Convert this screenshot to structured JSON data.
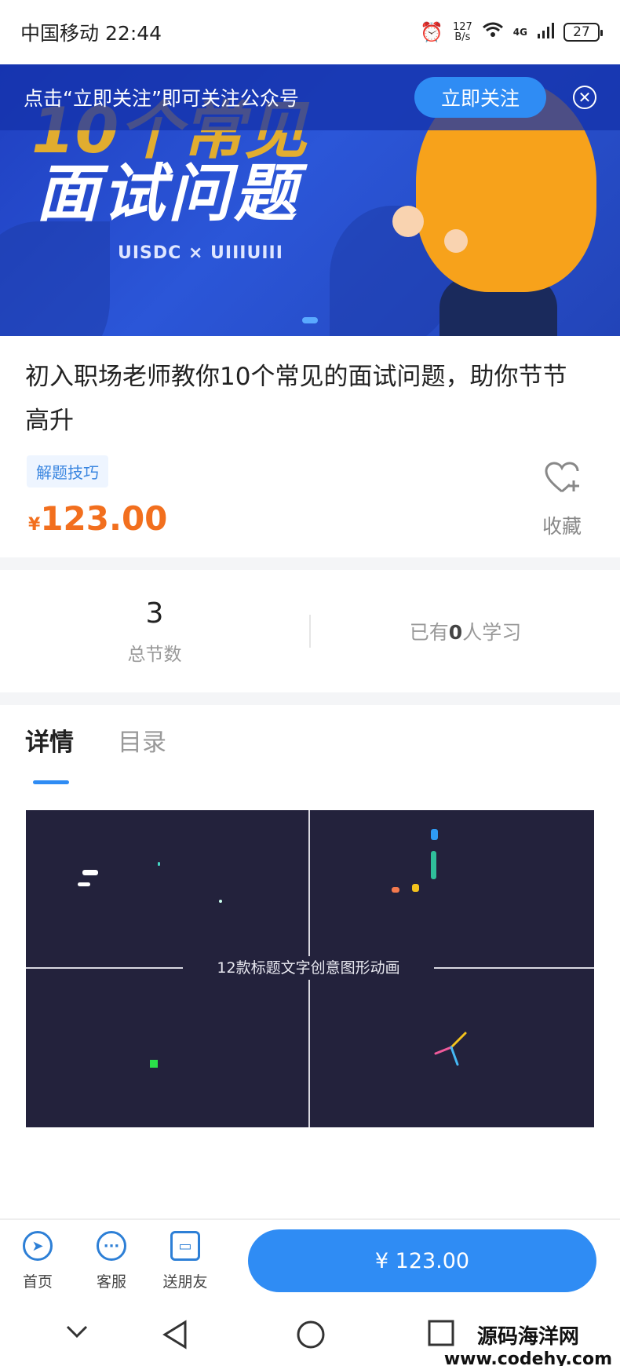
{
  "status_bar": {
    "carrier": "中国移动",
    "time": "22:44",
    "net_speed": "127",
    "net_unit": "B/s",
    "signal": "4G",
    "battery": "27"
  },
  "banner": {
    "headline_top": "10个常见",
    "headline": "面试问题",
    "subtitle": "UISDC × UIIIUIII",
    "follow_text": "点击“立即关注”即可关注公众号",
    "follow_button": "立即关注",
    "close_icon": "close-icon"
  },
  "course": {
    "title": "初入职场老师教你10个常见的面试问题，助你节节高升",
    "tag": "解题技巧",
    "currency": "¥",
    "price": "123.00",
    "favorite_label": "收藏",
    "favorite_icon": "heart-plus-icon"
  },
  "stats": {
    "lessons_count": "3",
    "lessons_label": "总节数",
    "learners_prefix": "已有",
    "learners_count": "0",
    "learners_suffix": "人学习"
  },
  "tabs": [
    {
      "label": "详情",
      "active": true
    },
    {
      "label": "目录",
      "active": false
    }
  ],
  "preview": {
    "caption": "12款标题文字创意图形动画"
  },
  "bottom_bar": {
    "items": [
      {
        "label": "首页",
        "icon": "compass-icon"
      },
      {
        "label": "客服",
        "icon": "chat-icon"
      },
      {
        "label": "送朋友",
        "icon": "gift-icon"
      }
    ],
    "buy_label": "¥ 123.00"
  },
  "watermark": {
    "line1": "源码海洋网",
    "line2": "www.codehy.com"
  },
  "colors": {
    "accent": "#2f8cf4",
    "price": "#f26f1e",
    "banner": "#2b56d8"
  }
}
